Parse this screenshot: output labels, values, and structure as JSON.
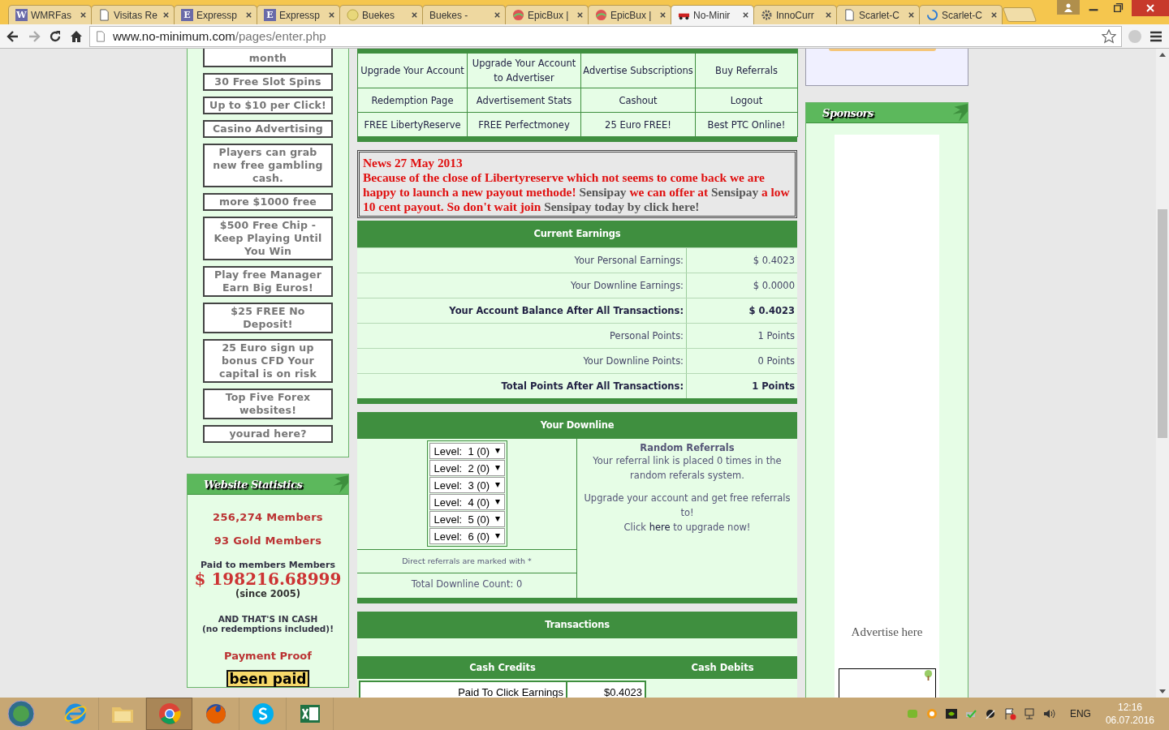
{
  "browser": {
    "tabs": [
      {
        "title": "WMRFas",
        "kind": "letter",
        "icon_text": "W",
        "selected": false
      },
      {
        "title": "Visitas Re",
        "kind": "page",
        "selected": false
      },
      {
        "title": "Expressp",
        "kind": "letter",
        "icon_text": "E",
        "selected": false
      },
      {
        "title": "Expressp",
        "kind": "letter",
        "icon_text": "E",
        "selected": false
      },
      {
        "title": "Buekes",
        "kind": "coin",
        "selected": false
      },
      {
        "title": "Buekes -",
        "kind": "plain",
        "selected": false
      },
      {
        "title": "EpicBux |",
        "kind": "globe",
        "selected": false
      },
      {
        "title": "EpicBux |",
        "kind": "globe",
        "selected": false
      },
      {
        "title": "No-Minir",
        "kind": "car",
        "selected": true
      },
      {
        "title": "InnoCurr",
        "kind": "gear",
        "selected": false
      },
      {
        "title": "Scarlet-C",
        "kind": "page",
        "selected": false
      },
      {
        "title": "Scarlet-C",
        "kind": "spinner",
        "selected": false
      }
    ],
    "url": {
      "domain": "www.no-minimum.com",
      "path": "/pages/enter.php"
    }
  },
  "left_ads": [
    "month",
    "30 Free Slot Spins",
    "Up to $10 per Click!",
    "Casino Advertising",
    "Players can grab new free gambling cash.",
    "more $1000 free",
    "$500 Free Chip - Keep Playing Until You Win",
    "Play free Manager Earn Big Euros!",
    "$25 FREE No Deposit!",
    "25 Euro sign up bonus CFD Your capital is on risk",
    "Top Five Forex websites!",
    "yourad here?"
  ],
  "stats": {
    "title": "Website Statistics",
    "members": "256,274 Members",
    "gold": "93 Gold Members",
    "paid_label": "Paid to members Members",
    "paid_amount": "$ 198216.68999",
    "since": "(since 2005)",
    "cash_line1": "AND THAT'S IN CASH",
    "cash_line2": "(no redemptions included)!",
    "proof": "Payment Proof",
    "badge": "been paid"
  },
  "menu": [
    [
      "Upgrade Your Account",
      "Upgrade Your Account to Advertiser",
      "Advertise Subscriptions",
      "Buy Referrals"
    ],
    [
      "Redemption Page",
      "Advertisement Stats",
      "Cashout",
      "Logout"
    ],
    [
      "FREE LibertyReserve",
      "FREE Perfectmoney",
      "25 Euro FREE!",
      "Best PTC Online!"
    ]
  ],
  "news": {
    "title": "News 27 May 2013",
    "parts": [
      {
        "kind": "text",
        "text": "Because of the close of Libertyreserve which not seems to come back we are happy to launch a new payout methode! "
      },
      {
        "kind": "link",
        "text": "Sensipay"
      },
      {
        "kind": "text",
        "text": " we can offer at "
      },
      {
        "kind": "link",
        "text": "Sensipay"
      },
      {
        "kind": "text",
        "text": " a low 10 cent payout. So don't wait join "
      },
      {
        "kind": "link",
        "text": "Sensipay today by click here!"
      }
    ]
  },
  "earnings": {
    "title": "Current Earnings",
    "rows": [
      {
        "label": "Your Personal Earnings:",
        "value": "$  0.4023",
        "bold": false
      },
      {
        "label": "Your Downline Earnings:",
        "value": "$  0.0000",
        "bold": false
      },
      {
        "label": "Your Account Balance After All Transactions:",
        "value": "$  0.4023",
        "bold": true
      },
      {
        "label": "Personal Points:",
        "value": "1 Points",
        "bold": false
      },
      {
        "label": "Your Downline Points:",
        "value": "0 Points",
        "bold": false
      },
      {
        "label": "Total Points After All Transactions:",
        "value": "1 Points",
        "bold": true
      }
    ]
  },
  "downline": {
    "title": "Your Downline",
    "levels": [
      "Level:  1 (0)",
      "Level:  2 (0)",
      "Level:  3 (0)",
      "Level:  4 (0)",
      "Level:  5 (0)",
      "Level:  6 (0)"
    ],
    "direct_note": "Direct referrals are marked with *",
    "total": "Total Downline Count: 0",
    "random_title": "Random Referrals",
    "random_text": "Your referral link is placed 0 times in the random referals system.",
    "upgrade_text": "Upgrade your account and get free referrals to!",
    "click_before": "Click",
    "click_link": "here",
    "click_after": "to upgrade now!"
  },
  "transactions": {
    "title": "Transactions",
    "credits": "Cash Credits",
    "debits": "Cash Debits",
    "rows": [
      {
        "label": "Paid To Click Earnings",
        "value": "$0.4023"
      }
    ]
  },
  "sponsors": {
    "title": "Sponsors",
    "advertise": "Advertise here"
  },
  "taskbar": {
    "apps": [
      {
        "kind": "ie",
        "selected": false
      },
      {
        "kind": "folder",
        "selected": false
      },
      {
        "kind": "chrome",
        "selected": true
      },
      {
        "kind": "firefox",
        "selected": false
      },
      {
        "kind": "skype",
        "selected": false
      },
      {
        "kind": "excel",
        "selected": false
      }
    ],
    "lang": "ENG",
    "time": "12:16",
    "date": "06.07.2016"
  }
}
